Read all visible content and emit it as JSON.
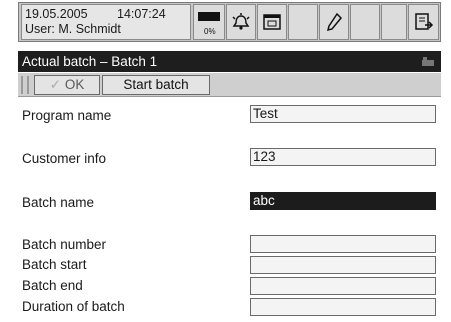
{
  "status": {
    "date": "19.05.2005",
    "time": "14:07:24",
    "user": "User: M. Schmidt",
    "level": "0%"
  },
  "icons": [
    "level-indicator-icon",
    "alarm-bell-icon",
    "window-icon",
    "pencil-icon",
    "export-icon"
  ],
  "window": {
    "title": "Actual batch – Batch 1"
  },
  "toolbar": {
    "ok_label": "OK",
    "start_label": "Start batch"
  },
  "form": {
    "program_name": {
      "label": "Program name",
      "value": "Test"
    },
    "customer_info": {
      "label": "Customer info",
      "value": "123"
    },
    "batch_name": {
      "label": "Batch name",
      "value": "abc"
    },
    "batch_number": {
      "label": "Batch number",
      "value": ""
    },
    "batch_start": {
      "label": "Batch start",
      "value": ""
    },
    "batch_end": {
      "label": "Batch end",
      "value": ""
    },
    "duration": {
      "label": "Duration of batch",
      "value": ""
    }
  },
  "colors": {
    "title_bar": "#1e1e1e",
    "selected_field": "#1c1c1c",
    "panel": "#c6c6c6"
  }
}
